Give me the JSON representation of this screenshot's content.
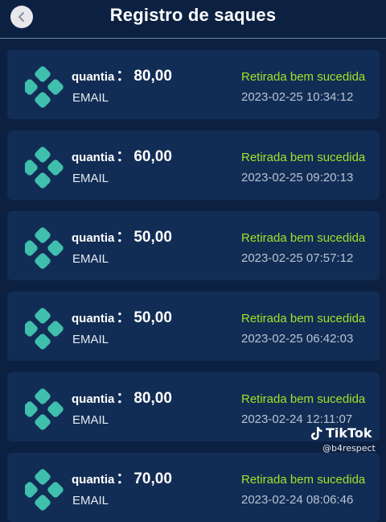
{
  "header": {
    "title": "Registro de saques"
  },
  "records": [
    {
      "label": "quantia",
      "colon": "：",
      "amount": "80,00",
      "method": "EMAIL",
      "status": "Retirada bem sucedida",
      "timestamp": "2023-02-25 10:34:12"
    },
    {
      "label": "quantia",
      "colon": "：",
      "amount": "60,00",
      "method": "EMAIL",
      "status": "Retirada bem sucedida",
      "timestamp": "2023-02-25 09:20:13"
    },
    {
      "label": "quantia",
      "colon": "：",
      "amount": "50,00",
      "method": "EMAIL",
      "status": "Retirada bem sucedida",
      "timestamp": "2023-02-25 07:57:12"
    },
    {
      "label": "quantia",
      "colon": "：",
      "amount": "50,00",
      "method": "EMAIL",
      "status": "Retirada bem sucedida",
      "timestamp": "2023-02-25 06:42:03"
    },
    {
      "label": "quantia",
      "colon": "：",
      "amount": "80,00",
      "method": "EMAIL",
      "status": "Retirada bem sucedida",
      "timestamp": "2023-02-24 12:11:07"
    },
    {
      "label": "quantia",
      "colon": "：",
      "amount": "70,00",
      "method": "EMAIL",
      "status": "Retirada bem sucedida",
      "timestamp": "2023-02-24 08:06:46"
    }
  ],
  "watermark": {
    "brand": "TikTok",
    "handle": "@b4respect"
  },
  "icons": {
    "back": "chevron-left-icon",
    "payment": "pix-logo-icon",
    "watermark": "tiktok-logo-icon"
  },
  "colors": {
    "background": "#0c2142",
    "card": "#122d55",
    "status": "#9ee32a",
    "logo": "#3fbfac"
  }
}
